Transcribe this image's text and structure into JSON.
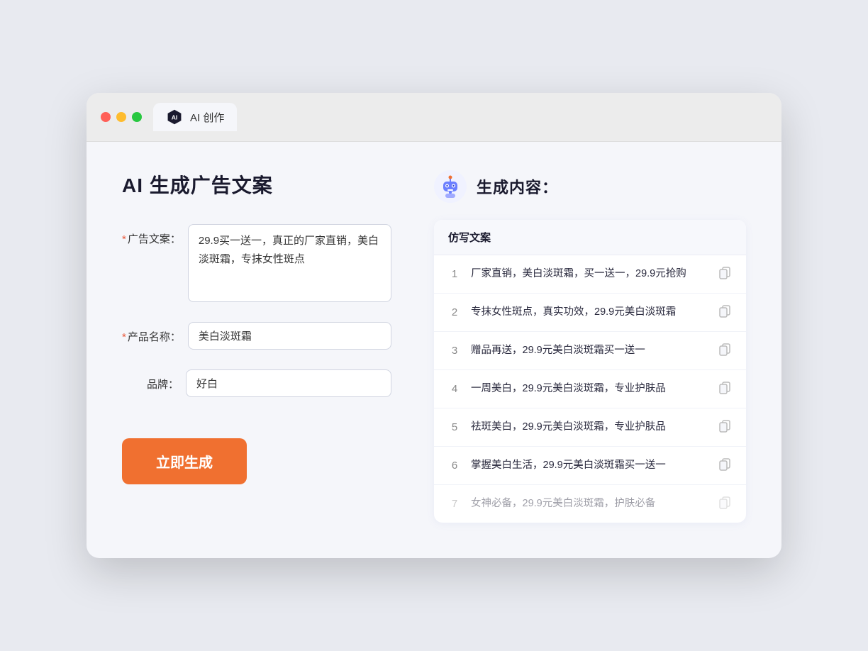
{
  "tab": {
    "label": "AI 创作"
  },
  "page": {
    "title": "AI 生成广告文案",
    "result_title": "生成内容："
  },
  "form": {
    "ad_label": "广告文案：",
    "ad_required": "*",
    "ad_value": "29.9买一送一，真正的厂家直销，美白淡斑霜，专抹女性斑点",
    "product_label": "产品名称：",
    "product_required": "*",
    "product_value": "美白淡斑霜",
    "brand_label": "品牌：",
    "brand_value": "好白",
    "generate_btn": "立即生成"
  },
  "result": {
    "column_header": "仿写文案",
    "items": [
      {
        "num": 1,
        "text": "厂家直销，美白淡斑霜，买一送一，29.9元抢购",
        "dimmed": false
      },
      {
        "num": 2,
        "text": "专抹女性斑点，真实功效，29.9元美白淡斑霜",
        "dimmed": false
      },
      {
        "num": 3,
        "text": "赠品再送，29.9元美白淡斑霜买一送一",
        "dimmed": false
      },
      {
        "num": 4,
        "text": "一周美白，29.9元美白淡斑霜，专业护肤品",
        "dimmed": false
      },
      {
        "num": 5,
        "text": "祛斑美白，29.9元美白淡斑霜，专业护肤品",
        "dimmed": false
      },
      {
        "num": 6,
        "text": "掌握美白生活，29.9元美白淡斑霜买一送一",
        "dimmed": false
      },
      {
        "num": 7,
        "text": "女神必备，29.9元美白淡斑霜，护肤必备",
        "dimmed": true
      }
    ]
  }
}
